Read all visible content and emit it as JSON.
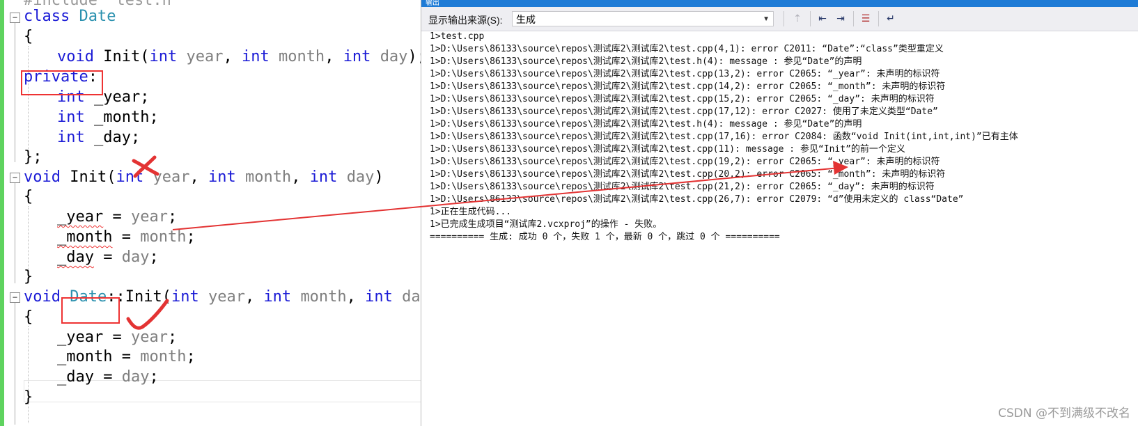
{
  "editor": {
    "top_text": "#include \"test.h\"",
    "code": {
      "class_kw": "class",
      "class_name": "Date",
      "open_brace": "{",
      "close_brace_semicolon": "};",
      "close_brace": "}",
      "void_kw": "void",
      "int_kw": "int",
      "private_kw": "private",
      "colon": ":",
      "init_fn": "Init",
      "param_year": "year",
      "param_month": "month",
      "param_day": "day",
      "member_year": "_year",
      "member_month": "_month",
      "member_day": "_day",
      "scope_op": "::",
      "assign": " = ",
      "semicolon": ";",
      "comma": ", ",
      "lparen": "(",
      "rparen": ")",
      "rparen_semicolon": ");"
    },
    "fold_glyph": "−"
  },
  "output": {
    "title": "输出",
    "source_label": "显示输出来源(S):",
    "source_value": "生成",
    "lines": [
      "1>test.cpp",
      "1>D:\\Users\\86133\\source\\repos\\测试库2\\测试库2\\test.cpp(4,1): error C2011: “Date”:“class”类型重定义",
      "1>D:\\Users\\86133\\source\\repos\\测试库2\\测试库2\\test.h(4): message : 参见“Date”的声明",
      "1>D:\\Users\\86133\\source\\repos\\测试库2\\测试库2\\test.cpp(13,2): error C2065: “_year”: 未声明的标识符",
      "1>D:\\Users\\86133\\source\\repos\\测试库2\\测试库2\\test.cpp(14,2): error C2065: “_month”: 未声明的标识符",
      "1>D:\\Users\\86133\\source\\repos\\测试库2\\测试库2\\test.cpp(15,2): error C2065: “_day”: 未声明的标识符",
      "1>D:\\Users\\86133\\source\\repos\\测试库2\\测试库2\\test.cpp(17,12): error C2027: 使用了未定义类型“Date”",
      "1>D:\\Users\\86133\\source\\repos\\测试库2\\测试库2\\test.h(4): message : 参见“Date”的声明",
      "1>D:\\Users\\86133\\source\\repos\\测试库2\\测试库2\\test.cpp(17,16): error C2084: 函数“void Init(int,int,int)”已有主体",
      "1>D:\\Users\\86133\\source\\repos\\测试库2\\测试库2\\test.cpp(11): message : 参见“Init”的前一个定义",
      "1>D:\\Users\\86133\\source\\repos\\测试库2\\测试库2\\test.cpp(19,2): error C2065: “_year”: 未声明的标识符",
      "1>D:\\Users\\86133\\source\\repos\\测试库2\\测试库2\\test.cpp(20,2): error C2065: “_month”: 未声明的标识符",
      "1>D:\\Users\\86133\\source\\repos\\测试库2\\测试库2\\test.cpp(21,2): error C2065: “_day”: 未声明的标识符",
      "1>D:\\Users\\86133\\source\\repos\\测试库2\\测试库2\\test.cpp(26,7): error C2079: “d”使用未定义的 class“Date”",
      "1>正在生成代码...",
      "1>已完成生成项目“测试库2.vcxproj”的操作 - 失败。",
      "========== 生成: 成功 0 个，失败 1 个，最新 0 个，跳过 0 个 =========="
    ]
  },
  "icons": {
    "toolbar": [
      "clear-disabled-icon",
      "find-prev-icon",
      "find-next-icon",
      "clear-all-icon",
      "word-wrap-icon"
    ]
  },
  "watermark": "CSDN @不到满级不改名",
  "colors": {
    "keyword": "#1b1bd6",
    "type": "#2b91af",
    "annotation_red": "#e33333",
    "gutter_green": "#5fd35f",
    "titlebar_blue": "#1e7bd6"
  }
}
